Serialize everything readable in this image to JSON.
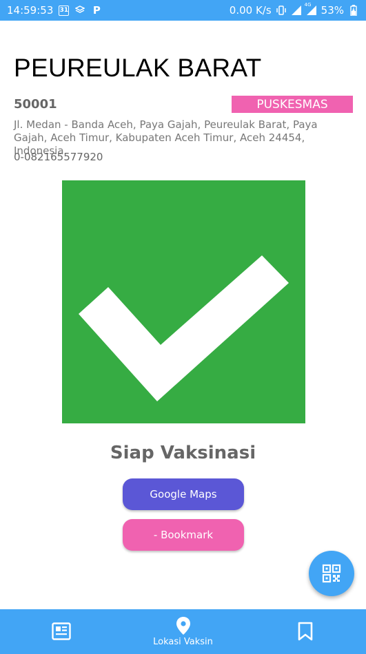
{
  "status_bar": {
    "time": "14:59:53",
    "calendar_day": "31",
    "app_badge": "P",
    "network_speed": "0.00 K/s",
    "network_type": "4G",
    "battery": "53%"
  },
  "facility": {
    "name": "PEUREULAK BARAT",
    "code": "50001",
    "type": "PUSKESMAS",
    "address": "Jl. Medan - Banda Aceh, Paya Gajah, Peureulak Barat, Paya Gajah, Aceh Timur, Kabupaten Aceh Timur, Aceh 24454, Indonesia",
    "phone": "0-082165577920"
  },
  "status": {
    "icon": "checkmark-icon",
    "text": "Siap Vaksinasi",
    "color": "#36ac43"
  },
  "actions": {
    "maps_label": "Google Maps",
    "bookmark_label": "- Bookmark"
  },
  "fab": {
    "icon": "qr-code-icon"
  },
  "bottom_nav": {
    "items": [
      {
        "icon": "news-icon",
        "label": ""
      },
      {
        "icon": "location-pin-icon",
        "label": "Lokasi Vaksin"
      },
      {
        "icon": "bookmark-icon",
        "label": ""
      }
    ]
  },
  "colors": {
    "primary": "#42a5f5",
    "badge": "#f062b0",
    "maps_button": "#5b57d6",
    "bookmark_button": "#f062b0"
  }
}
